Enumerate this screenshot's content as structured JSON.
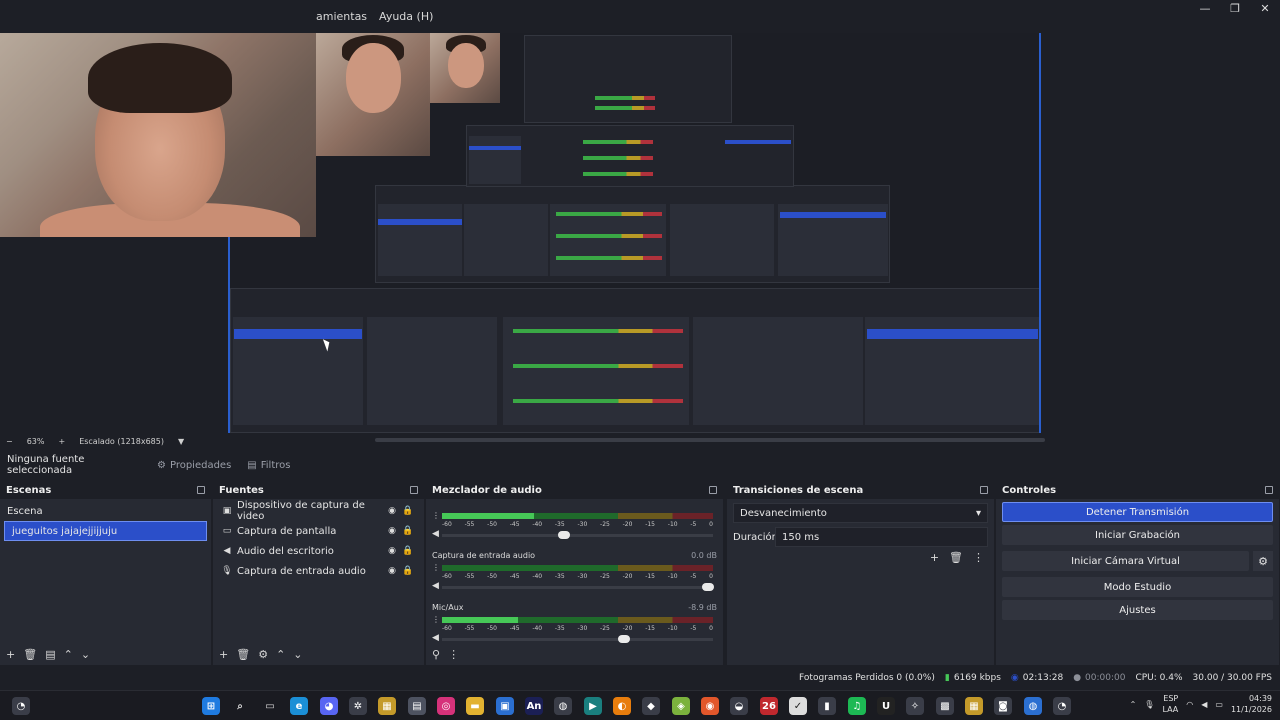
{
  "menu": {
    "items": [
      "amientas",
      "Ayuda (H)"
    ]
  },
  "window_controls": {
    "minimize": "—",
    "restore": "❐",
    "close": "✕"
  },
  "preview_status": {
    "zoom": "63%",
    "scale": "Escalado (1218x685)"
  },
  "context_bar": {
    "no_source": "Ninguna fuente seleccionada",
    "properties": "Propiedades",
    "filters": "Filtros"
  },
  "scenes": {
    "title": "Escenas",
    "items": [
      {
        "label": "Escena",
        "active": false
      },
      {
        "label": "jueguitos jajajejjijjuju",
        "active": true
      }
    ]
  },
  "sources": {
    "title": "Fuentes",
    "items": [
      {
        "label": "Dispositivo de captura de video",
        "icon": "camera-icon"
      },
      {
        "label": "Captura de pantalla",
        "icon": "monitor-icon"
      },
      {
        "label": "Audio del escritorio",
        "icon": "speaker-icon"
      },
      {
        "label": "Captura de entrada audio",
        "icon": "microphone-icon"
      }
    ]
  },
  "mixer": {
    "title": "Mezclador de audio",
    "scale": [
      "-60",
      "-55",
      "-50",
      "-45",
      "-40",
      "-35",
      "-30",
      "-25",
      "-20",
      "-15",
      "-10",
      "-5",
      "0"
    ],
    "channels": [
      {
        "name": "",
        "db": "",
        "level": 0.34,
        "volume": 0.45
      },
      {
        "name": "Captura de entrada audio",
        "db": "0.0 dB",
        "level": 0.0,
        "volume": 0.98
      },
      {
        "name": "Mic/Aux",
        "db": "-8.9 dB",
        "level": 0.28,
        "volume": 0.67
      }
    ]
  },
  "transitions": {
    "title": "Transiciones de escena",
    "selected": "Desvanecimiento",
    "duration_label": "Duración",
    "duration_value": "150 ms"
  },
  "controls": {
    "title": "Controles",
    "stop_stream": "Detener Transmisión",
    "start_recording": "Iniciar Grabación",
    "virtual_camera": "Iniciar Cámara Virtual",
    "studio_mode": "Modo Estudio",
    "settings": "Ajustes"
  },
  "status": {
    "dropped": "Fotogramas Perdidos 0 (0.0%)",
    "bitrate": "6169 kbps",
    "live_time": "02:13:28",
    "rec_time": "00:00:00",
    "cpu": "CPU: 0.4%",
    "fps": "30.00 / 30.00 FPS"
  },
  "tray": {
    "lang1": "ESP",
    "lang2": "LAA",
    "time": "04:39",
    "date": "11/1/2026"
  },
  "colors": {
    "accent": "#2b4fc9",
    "panel": "#272a33",
    "bg": "#1d1f26"
  }
}
